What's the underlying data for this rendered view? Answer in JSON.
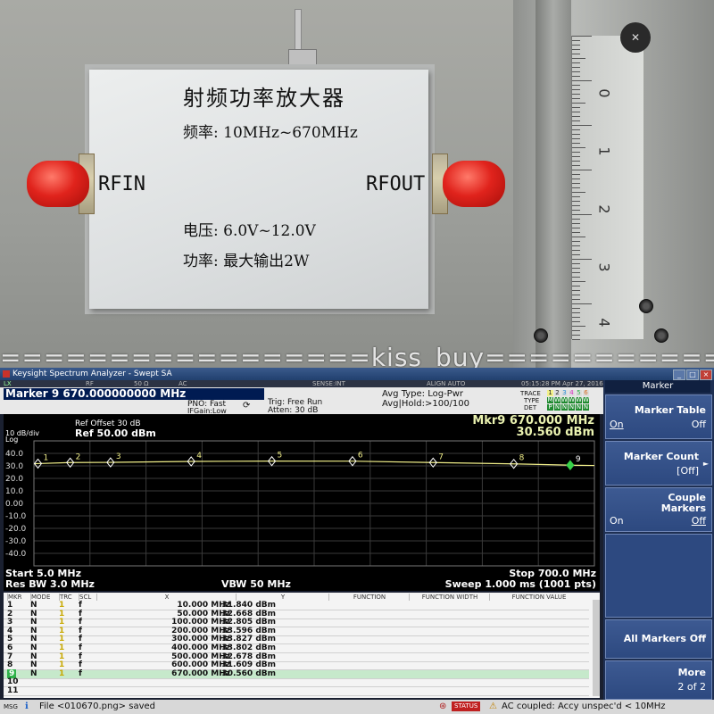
{
  "photo": {
    "module_title": "射频功率放大器",
    "freq_label": "频率: 10MHz~670MHz",
    "rfin_label": "RFIN",
    "rfout_label": "RFOUT",
    "voltage_label": "电压: 6.0V~12.0V",
    "power_label": "功率: 最大输出2W",
    "watermark": "=================kiss_buy=================",
    "caliper_numbers": [
      "0",
      "1",
      "2",
      "3",
      "4"
    ]
  },
  "analyzer": {
    "window_title": "Keysight Spectrum Analyzer - Swept SA",
    "status_row": {
      "rf": "RF",
      "ohm": "50 Ω",
      "ac": "AC",
      "sense": "SENSE:INT",
      "align": "ALIGN AUTO",
      "datetime": "05:15:28 PM Apr 27, 2016"
    },
    "info": {
      "marker_header": "Marker 9  670.000000000 MHz",
      "pno": "PNO: Fast",
      "ifgain": "IFGain:Low",
      "trig": "Trig: Free Run",
      "atten": "Atten: 30 dB",
      "avg_type": "Avg Type: Log-Pwr",
      "avg_hold": "Avg|Hold:>100/100",
      "trace_label": "TRACE",
      "type_label": "TYPE",
      "det_label": "DET",
      "trace_nums": [
        "1",
        "2",
        "3",
        "4",
        "5",
        "6"
      ],
      "type_vals": [
        "M",
        "W",
        "W",
        "W",
        "W",
        "W"
      ],
      "det_vals": [
        "P",
        "N",
        "N",
        "N",
        "N",
        "N"
      ]
    },
    "plot": {
      "scale": "10 dB/div",
      "log": "Log",
      "ref_offset": "Ref Offset 30 dB",
      "ref_level": "Ref 50.00 dBm",
      "mkr_line1": "Mkr9 670.000 MHz",
      "mkr_line2": "30.560 dBm",
      "y_ticks": [
        "40.0",
        "30.0",
        "20.0",
        "10.0",
        "0.00",
        "-10.0",
        "-20.0",
        "-30.0",
        "-40.0"
      ],
      "start": "Start 5.0 MHz",
      "stop": "Stop 700.0 MHz",
      "rbw": "Res BW 3.0 MHz",
      "vbw": "VBW 50 MHz",
      "sweep": "Sweep   1.000 ms (1001 pts)"
    },
    "table": {
      "headers": [
        "MKR",
        "MODE",
        "TRC",
        "SCL",
        "X",
        "Y",
        "FUNCTION",
        "FUNCTION WIDTH",
        "FUNCTION VALUE"
      ],
      "rows": [
        {
          "mkr": "1",
          "mode": "N",
          "trc": "1",
          "scl": "f",
          "x": "10.000 MHz",
          "y": "31.840 dBm"
        },
        {
          "mkr": "2",
          "mode": "N",
          "trc": "1",
          "scl": "f",
          "x": "50.000 MHz",
          "y": "32.668 dBm"
        },
        {
          "mkr": "3",
          "mode": "N",
          "trc": "1",
          "scl": "f",
          "x": "100.000 MHz",
          "y": "32.805 dBm"
        },
        {
          "mkr": "4",
          "mode": "N",
          "trc": "1",
          "scl": "f",
          "x": "200.000 MHz",
          "y": "33.596 dBm"
        },
        {
          "mkr": "5",
          "mode": "N",
          "trc": "1",
          "scl": "f",
          "x": "300.000 MHz",
          "y": "33.827 dBm"
        },
        {
          "mkr": "6",
          "mode": "N",
          "trc": "1",
          "scl": "f",
          "x": "400.000 MHz",
          "y": "33.802 dBm"
        },
        {
          "mkr": "7",
          "mode": "N",
          "trc": "1",
          "scl": "f",
          "x": "500.000 MHz",
          "y": "32.678 dBm"
        },
        {
          "mkr": "8",
          "mode": "N",
          "trc": "1",
          "scl": "f",
          "x": "600.000 MHz",
          "y": "31.609 dBm"
        },
        {
          "mkr": "9",
          "mode": "N",
          "trc": "1",
          "scl": "f",
          "x": "670.000 MHz",
          "y": "30.560 dBm"
        },
        {
          "mkr": "10",
          "mode": "",
          "trc": "",
          "scl": "",
          "x": "",
          "y": ""
        },
        {
          "mkr": "11",
          "mode": "",
          "trc": "",
          "scl": "",
          "x": "",
          "y": ""
        }
      ]
    },
    "softkeys": {
      "title": "Marker",
      "marker_table": "Marker Table",
      "marker_table_on": "On",
      "marker_table_off": "Off",
      "marker_count": "Marker Count",
      "marker_count_val": "[Off]",
      "couple": "Couple",
      "markers": "Markers",
      "couple_on": "On",
      "couple_off": "Off",
      "all_off": "All Markers Off",
      "more": "More",
      "page": "2 of 2"
    },
    "msg": {
      "msg_label": "MSG",
      "file_msg": "File <010670.png> saved",
      "status": "STATUS",
      "ac_msg": "AC coupled: Accy unspec'd < 10MHz"
    },
    "colors": {
      "trace": "#f2f08a",
      "marker_active": "#39d24a",
      "grid": "#3a3a3a",
      "accent_header": "#001b52"
    }
  },
  "chart_data": {
    "type": "line",
    "title": "",
    "xlabel": "",
    "ylabel": "",
    "xlim": [
      5.0,
      700.0
    ],
    "ylim": [
      -50,
      50
    ],
    "x_unit": "MHz",
    "y_unit": "dBm",
    "grid": true,
    "series": [
      {
        "x": [
          5,
          10,
          50,
          100,
          200,
          300,
          400,
          500,
          600,
          670,
          700
        ],
        "y": [
          31.7,
          31.84,
          32.668,
          32.805,
          33.596,
          33.827,
          33.802,
          32.678,
          31.609,
          30.56,
          30.3
        ]
      }
    ],
    "markers": [
      {
        "label": "1",
        "x": 10,
        "y": 31.84
      },
      {
        "label": "2",
        "x": 50,
        "y": 32.668
      },
      {
        "label": "3",
        "x": 100,
        "y": 32.805
      },
      {
        "label": "4",
        "x": 200,
        "y": 33.596
      },
      {
        "label": "5",
        "x": 300,
        "y": 33.827
      },
      {
        "label": "6",
        "x": 400,
        "y": 33.802
      },
      {
        "label": "7",
        "x": 500,
        "y": 32.678
      },
      {
        "label": "8",
        "x": 600,
        "y": 31.609
      },
      {
        "label": "9",
        "x": 670,
        "y": 30.56
      }
    ]
  }
}
